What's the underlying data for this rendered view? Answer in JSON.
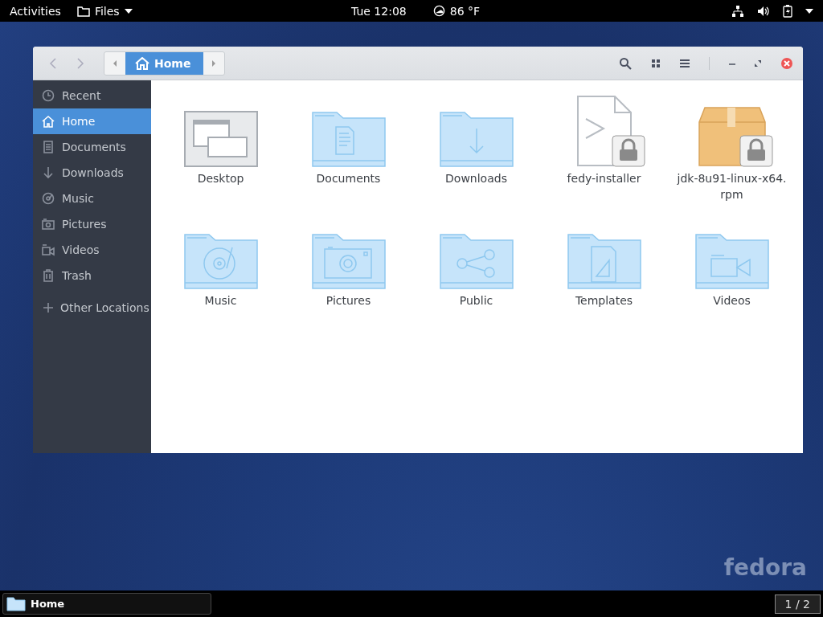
{
  "top_bar": {
    "activities": "Activities",
    "app_menu": "Files",
    "clock": "Tue 12:08",
    "weather": "86 °F"
  },
  "window": {
    "location": "Home",
    "sidebar": {
      "items": [
        {
          "label": "Recent",
          "kind": "recent",
          "selected": false
        },
        {
          "label": "Home",
          "kind": "home",
          "selected": true
        },
        {
          "label": "Documents",
          "kind": "documents",
          "selected": false
        },
        {
          "label": "Downloads",
          "kind": "downloads",
          "selected": false
        },
        {
          "label": "Music",
          "kind": "music",
          "selected": false
        },
        {
          "label": "Pictures",
          "kind": "pictures",
          "selected": false
        },
        {
          "label": "Videos",
          "kind": "videos",
          "selected": false
        },
        {
          "label": "Trash",
          "kind": "trash",
          "selected": false
        }
      ],
      "other_locations": "Other Locations"
    },
    "files": [
      {
        "name": "Desktop",
        "kind": "desktop",
        "locked": false
      },
      {
        "name": "Documents",
        "kind": "documents",
        "locked": false
      },
      {
        "name": "Downloads",
        "kind": "downloads",
        "locked": false
      },
      {
        "name": "fedy-installer",
        "kind": "script",
        "locked": true
      },
      {
        "name": "jdk-8u91-linux-x64.\nrpm",
        "kind": "package",
        "locked": true
      },
      {
        "name": "Music",
        "kind": "music",
        "locked": false
      },
      {
        "name": "Pictures",
        "kind": "pictures",
        "locked": false
      },
      {
        "name": "Public",
        "kind": "public",
        "locked": false
      },
      {
        "name": "Templates",
        "kind": "templates",
        "locked": false
      },
      {
        "name": "Videos",
        "kind": "videos",
        "locked": false
      }
    ]
  },
  "wallpaper_logo": "fedora",
  "taskbar": {
    "task": "Home",
    "workspace": "1 / 2"
  }
}
